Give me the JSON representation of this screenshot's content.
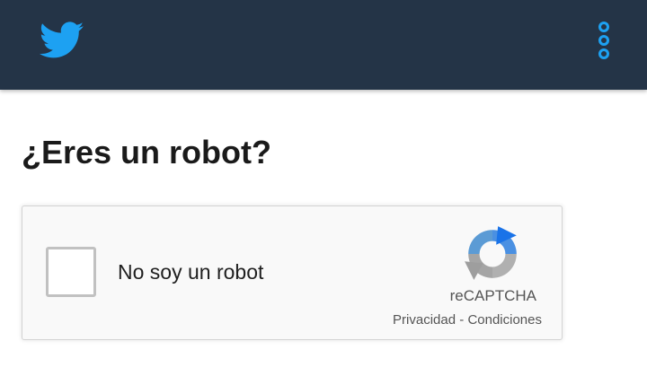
{
  "header": {
    "logo_icon": "twitter-bird-icon",
    "menu_icon": "more-vertical-icon",
    "background_color": "#243447",
    "accent_color": "#1da1f2"
  },
  "main": {
    "title": "¿Eres un robot?"
  },
  "recaptcha": {
    "checkbox_label": "No soy un robot",
    "checked": false,
    "logo_icon": "recaptcha-logo-icon",
    "brand": "reCAPTCHA",
    "privacy_link": "Privacidad",
    "separator": " - ",
    "terms_link": "Condiciones"
  }
}
